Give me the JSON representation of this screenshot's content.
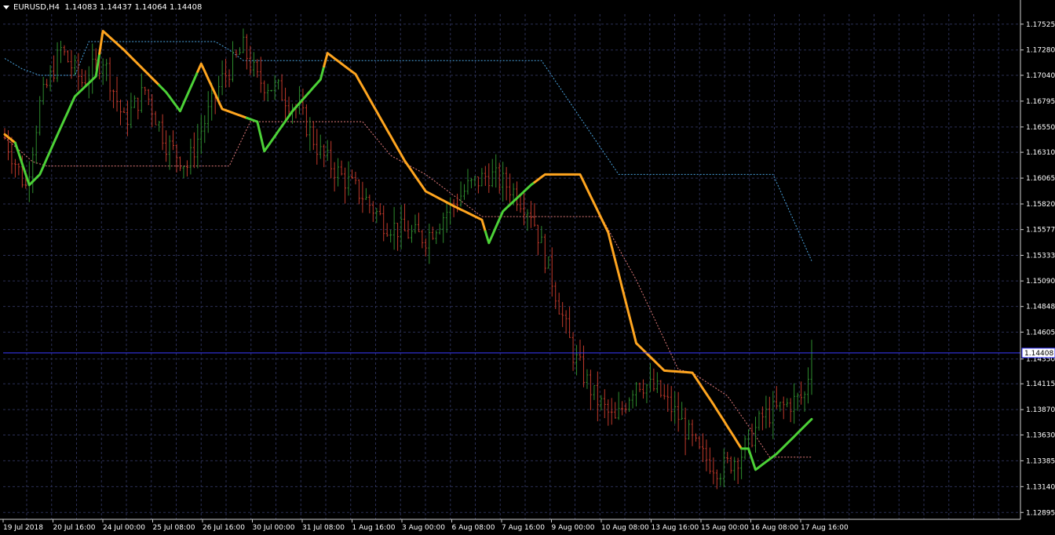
{
  "header": {
    "symbol_timeframe": "EURUSD,H4",
    "quote": "1.14083 1.14437 1.14064 1.14408"
  },
  "colors": {
    "background": "#000000",
    "grid": "#2b2f55",
    "frame": "#d0d0d0",
    "bull_candle": "#2e8b2e",
    "bear_candle": "#c0392b",
    "trend_up": "#4cd137",
    "trend_down": "#ffa51f",
    "upper_band": "#4aa3df",
    "lower_band": "#e07a7a",
    "price_line": "#3a3aff"
  },
  "chart_data": {
    "type": "candlestick",
    "symbol": "EURUSD",
    "timeframe": "H4",
    "ylim": [
      1.1283,
      1.1762
    ],
    "price_ticks": [
      "1.17525",
      "1.17280",
      "1.17040",
      "1.16795",
      "1.16550",
      "1.16310",
      "1.16065",
      "1.15820",
      "1.15577",
      "1.15333",
      "1.15090",
      "1.14848",
      "1.14605",
      "1.14350",
      "1.14115",
      "1.13870",
      "1.13630",
      "1.13385",
      "1.13140",
      "1.12895"
    ],
    "current_price": "1.14408",
    "time_labels": [
      "19 Jul 2018",
      "20 Jul 16:00",
      "24 Jul 00:00",
      "25 Jul 08:00",
      "26 Jul 16:00",
      "30 Jul 00:00",
      "31 Jul 08:00",
      "1 Aug 16:00",
      "3 Aug 00:00",
      "6 Aug 08:00",
      "7 Aug 16:00",
      "9 Aug 00:00",
      "10 Aug 08:00",
      "13 Aug 16:00",
      "15 Aug 00:00",
      "16 Aug 08:00",
      "17 Aug 16:00"
    ],
    "close_anchors": [
      [
        0,
        1.1645
      ],
      [
        6,
        1.1598
      ],
      [
        10,
        1.1676
      ],
      [
        16,
        1.1728
      ],
      [
        22,
        1.1698
      ],
      [
        28,
        1.172
      ],
      [
        34,
        1.166
      ],
      [
        40,
        1.169
      ],
      [
        46,
        1.164
      ],
      [
        52,
        1.1618
      ],
      [
        56,
        1.1652
      ],
      [
        62,
        1.17
      ],
      [
        68,
        1.173
      ],
      [
        72,
        1.17
      ],
      [
        78,
        1.169
      ],
      [
        84,
        1.167
      ],
      [
        90,
        1.163
      ],
      [
        96,
        1.1608
      ],
      [
        102,
        1.159
      ],
      [
        108,
        1.1565
      ],
      [
        114,
        1.1555
      ],
      [
        120,
        1.155
      ],
      [
        126,
        1.1575
      ],
      [
        132,
        1.1598
      ],
      [
        138,
        1.161
      ],
      [
        144,
        1.1598
      ],
      [
        150,
        1.1575
      ],
      [
        156,
        1.151
      ],
      [
        162,
        1.144
      ],
      [
        168,
        1.14
      ],
      [
        174,
        1.1375
      ],
      [
        180,
        1.1415
      ],
      [
        186,
        1.1405
      ],
      [
        192,
        1.138
      ],
      [
        198,
        1.1345
      ],
      [
        204,
        1.133
      ],
      [
        210,
        1.1345
      ],
      [
        216,
        1.138
      ],
      [
        222,
        1.139
      ],
      [
        228,
        1.14
      ],
      [
        230,
        1.14408
      ]
    ],
    "series": [
      {
        "name": "upper",
        "values": [
          [
            0,
            1.172
          ],
          [
            5,
            1.171
          ],
          [
            10,
            1.1704
          ],
          [
            20,
            1.1704
          ],
          [
            24,
            1.1736
          ],
          [
            60,
            1.1736
          ],
          [
            64,
            1.1728
          ],
          [
            68,
            1.1718
          ],
          [
            153,
            1.1718
          ],
          [
            175,
            1.161
          ],
          [
            219,
            1.161
          ],
          [
            230,
            1.1528
          ]
        ]
      },
      {
        "name": "lower",
        "values": [
          [
            0,
            1.1645
          ],
          [
            8,
            1.1622
          ],
          [
            12,
            1.1618
          ],
          [
            64,
            1.1618
          ],
          [
            70,
            1.166
          ],
          [
            102,
            1.166
          ],
          [
            110,
            1.1628
          ],
          [
            120,
            1.161
          ],
          [
            136,
            1.157
          ],
          [
            170,
            1.157
          ],
          [
            180,
            1.151
          ],
          [
            192,
            1.1425
          ],
          [
            196,
            1.1422
          ],
          [
            206,
            1.14
          ],
          [
            214,
            1.1362
          ],
          [
            218,
            1.1342
          ],
          [
            230,
            1.1342
          ]
        ]
      },
      {
        "name": "trend",
        "values": [
          [
            0,
            1.1648
          ],
          [
            3,
            1.164
          ],
          [
            7,
            1.16
          ],
          [
            10,
            1.161
          ],
          [
            14,
            1.164
          ],
          [
            20,
            1.1684
          ],
          [
            26,
            1.1703
          ],
          [
            28,
            1.1746
          ],
          [
            34,
            1.1728
          ],
          [
            46,
            1.1688
          ],
          [
            50,
            1.167
          ],
          [
            56,
            1.1715
          ],
          [
            62,
            1.1672
          ],
          [
            72,
            1.166
          ],
          [
            74,
            1.1632
          ],
          [
            82,
            1.167
          ],
          [
            90,
            1.17
          ],
          [
            92,
            1.1725
          ],
          [
            100,
            1.1705
          ],
          [
            108,
            1.1658
          ],
          [
            114,
            1.1623
          ],
          [
            120,
            1.1594
          ],
          [
            128,
            1.158
          ],
          [
            136,
            1.1567
          ],
          [
            138,
            1.1545
          ],
          [
            142,
            1.1575
          ],
          [
            150,
            1.16
          ],
          [
            154,
            1.161
          ],
          [
            164,
            1.161
          ],
          [
            172,
            1.1555
          ],
          [
            180,
            1.145
          ],
          [
            188,
            1.1424
          ],
          [
            196,
            1.1422
          ],
          [
            202,
            1.1392
          ],
          [
            210,
            1.135
          ],
          [
            212,
            1.135
          ],
          [
            214,
            1.133
          ],
          [
            220,
            1.1345
          ],
          [
            230,
            1.1378
          ]
        ]
      },
      {
        "name": "trend_state",
        "values": [
          [
            0,
            "down"
          ],
          [
            4,
            "up"
          ],
          [
            28,
            "down"
          ],
          [
            45,
            "up"
          ],
          [
            56,
            "down"
          ],
          [
            70,
            "up"
          ],
          [
            74,
            "up"
          ],
          [
            92,
            "down"
          ],
          [
            138,
            "up"
          ],
          [
            152,
            "down"
          ],
          [
            211,
            "up"
          ]
        ]
      }
    ]
  }
}
